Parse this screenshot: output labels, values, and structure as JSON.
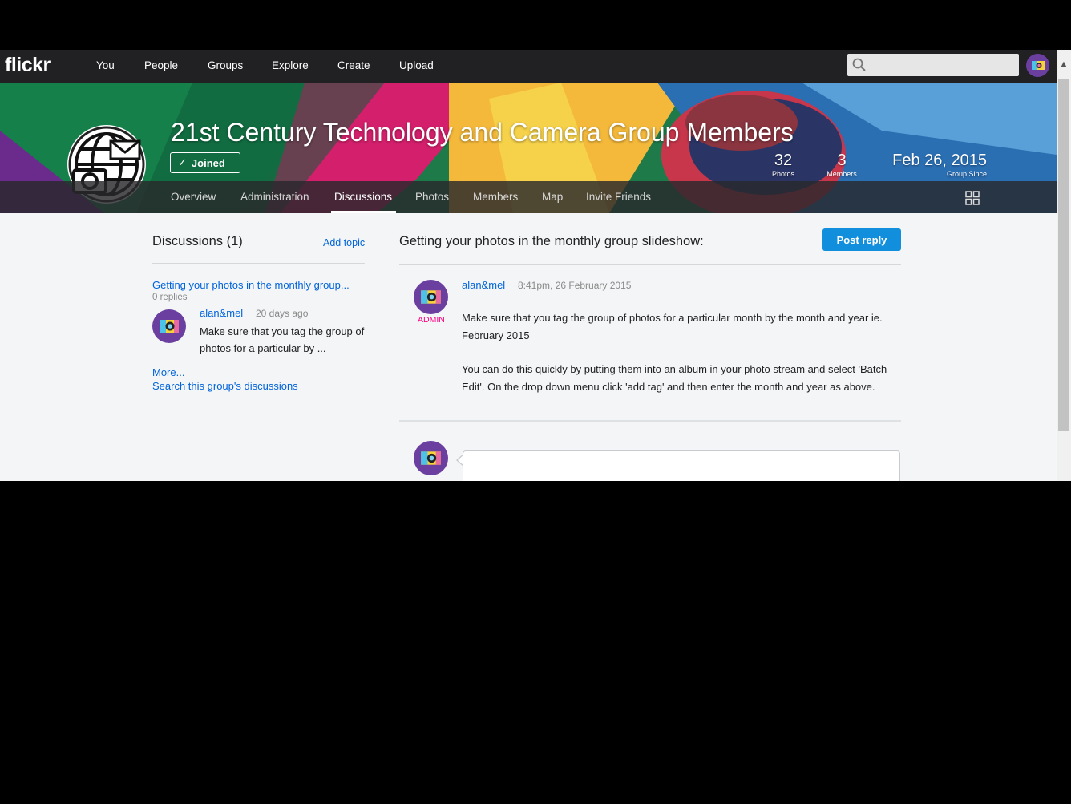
{
  "nav": {
    "logo": "flickr",
    "links": [
      "You",
      "People",
      "Groups",
      "Explore",
      "Create",
      "Upload"
    ],
    "search_placeholder": ""
  },
  "group": {
    "title": "21st Century Technology and Camera Group Members",
    "joined_label": "Joined",
    "stats": [
      {
        "value": "32",
        "label": "Photos"
      },
      {
        "value": "3",
        "label": "Members"
      },
      {
        "value": "Feb 26, 2015",
        "label": "Group Since"
      }
    ],
    "tabs": [
      "Overview",
      "Administration",
      "Discussions",
      "Photos",
      "Members",
      "Map",
      "Invite Friends"
    ],
    "active_tab": "Discussions"
  },
  "sidebar": {
    "heading": "Discussions (1)",
    "add_topic": "Add topic",
    "topic": {
      "title": "Getting your photos in the monthly group...",
      "replies": "0 replies",
      "author": "alan&mel",
      "time": "20 days ago",
      "excerpt": "Make sure that you tag the group of photos for a particular by ..."
    },
    "more": "More...",
    "search_link": "Search this group's discussions"
  },
  "thread": {
    "title": "Getting your photos in the monthly group slideshow:",
    "post_reply": "Post reply",
    "post": {
      "author": "alan&mel",
      "time": "8:41pm, 26 February 2015",
      "badge": "ADMIN",
      "paragraphs": [
        "Make sure that you tag the group of photos for a particular month by the month and year ie. February 2015",
        "You can do this quickly by putting them into an album in your photo stream and select 'Batch Edit'. On the drop down menu click 'add tag' and then enter the month and year as above."
      ]
    }
  },
  "colors": {
    "link": "#0063dc",
    "nav_bg": "#212124",
    "button": "#128fdc",
    "admin": "#ff0084",
    "avatar": "#6b3fa0"
  }
}
